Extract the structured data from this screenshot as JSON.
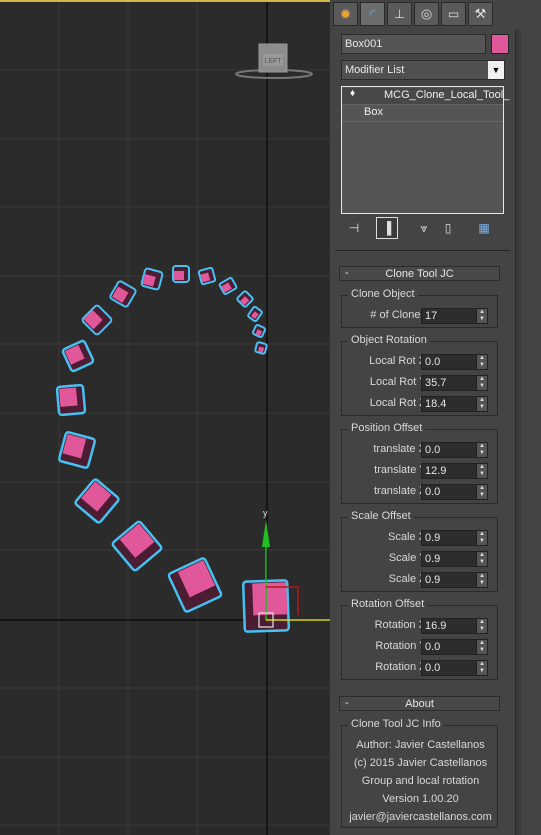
{
  "viewport": {
    "nav_cube_label": "LEFT",
    "gizmo_axis_label": "y"
  },
  "panel": {
    "tabs": [
      {
        "icon": "create-icon"
      },
      {
        "icon": "modify-icon"
      },
      {
        "icon": "hierarchy-icon"
      },
      {
        "icon": "motion-icon"
      },
      {
        "icon": "display-icon"
      },
      {
        "icon": "utilities-icon"
      }
    ],
    "object_name": "Box001",
    "object_color": "#e0579a",
    "modifier_list": "Modifier List",
    "stack_items": [
      "MCG_Clone_Local_Tool_",
      "Box"
    ]
  },
  "clone_tool": {
    "title": "Clone Tool JC",
    "clone_object": {
      "label": "Clone Object",
      "clones_label": "# of Clones:",
      "clones_value": "17"
    },
    "object_rotation": {
      "label": "Object Rotation",
      "x_label": "Local Rot X:",
      "x": "0.0",
      "y_label": "Local Rot Y:",
      "y": "35.7",
      "z_label": "Local Rot Z:",
      "z": "18.4"
    },
    "position_offset": {
      "label": "Position Offset",
      "x_label": "translate X:",
      "x": "0.0",
      "y_label": "translate Y:",
      "y": "12.9",
      "z_label": "translate Z:",
      "z": "0.0"
    },
    "scale_offset": {
      "label": "Scale Offset",
      "x_label": "Scale X:",
      "x": "0.9",
      "y_label": "Scale Y:",
      "y": "0.9",
      "z_label": "Scale Z:",
      "z": "0.9"
    },
    "rotation_offset": {
      "label": "Rotation Offset",
      "x_label": "Rotation X:",
      "x": "16.9",
      "y_label": "Rotation Y:",
      "y": "0.0",
      "z_label": "Rotation Z:",
      "z": "0.0"
    }
  },
  "about": {
    "title": "About",
    "group_label": "Clone Tool JC Info",
    "lines": [
      "Author: Javier Castellanos",
      "(c) 2015 Javier Castellanos",
      "Group and local rotation",
      "Version 1.00.20",
      "javier@javiercastellanos.com"
    ]
  }
}
